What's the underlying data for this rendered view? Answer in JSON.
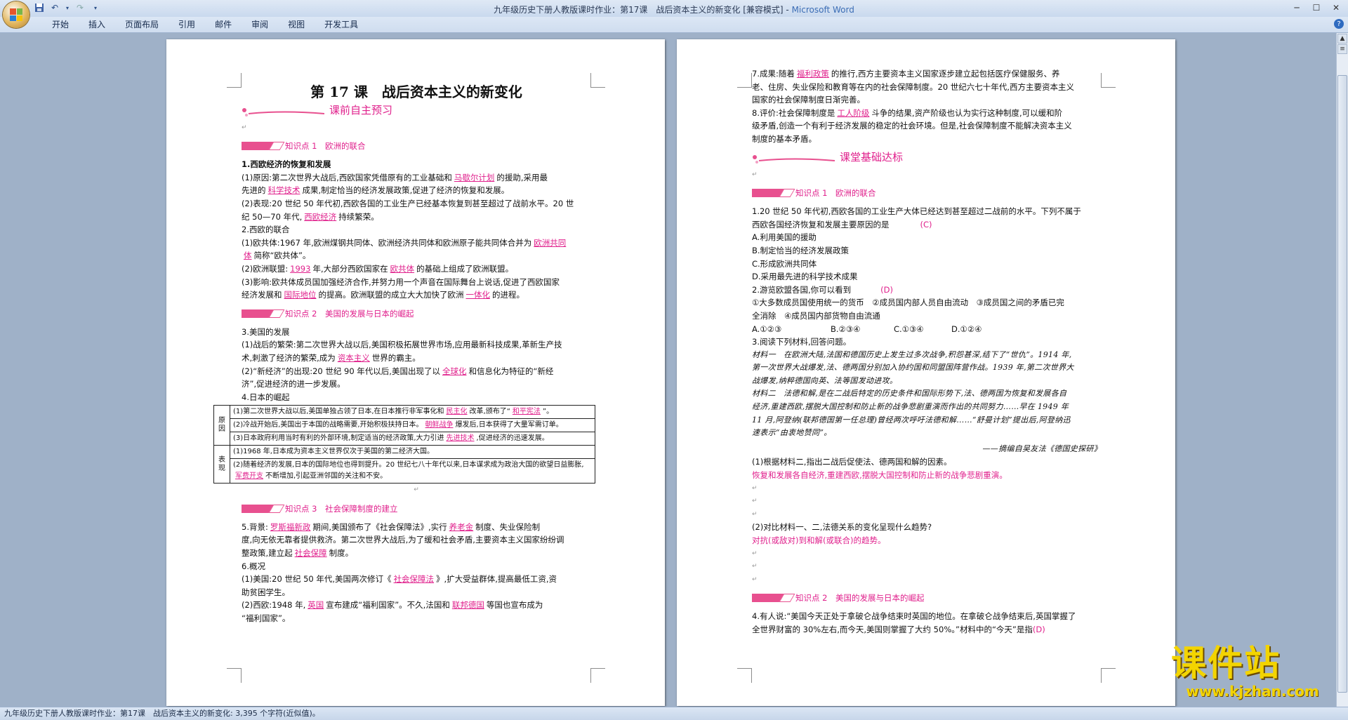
{
  "window": {
    "title": "九年级历史下册人教版课时作业：第17课　战后资本主义的新变化 [兼容模式]",
    "separator": " - ",
    "app": "Microsoft Word"
  },
  "menu": [
    "开始",
    "插入",
    "页面布局",
    "引用",
    "邮件",
    "审阅",
    "视图",
    "开发工具"
  ],
  "status": {
    "text": "九年级历史下册人教版课时作业：第17课　战后资本主义的新变化: 3,395 个字符(近似值)。"
  },
  "watermark": {
    "brand": "课件站",
    "url": "www.kjzhan.com"
  },
  "page1": {
    "title": "第 17 课　战后资本主义的新变化",
    "section_pre": "课前自主预习",
    "kp1": "知识点 1　欧洲的联合",
    "l1": "1.西欧经济的恢复和发展",
    "l2a": "(1)原因:第二次世界大战后,西欧国家凭借原有的工业基础和",
    "f1": "马歇尔计划",
    "l2b": "的援助,采用最",
    "l3a": "先进的",
    "f2": "科学技术",
    "l3b": "成果,制定恰当的经济发展政策,促进了经济的恢复和发展。",
    "l4": "(2)表现:20 世纪 50 年代初,西欧各国的工业生产已经基本恢复到甚至超过了战前水平。20 世",
    "l5a": "纪 50—70 年代,",
    "f3": "西欧经济",
    "l5b": "持续繁荣。",
    "l6": "2.西欧的联合",
    "l7a": "(1)欧共体:1967 年,欧洲煤钢共同体、欧洲经济共同体和欧洲原子能共同体合并为",
    "f4a": "欧洲共同",
    "f4b": "体",
    "l8b": "简称“欧共体”。",
    "l9a": "(2)欧洲联盟:",
    "f5": "1993",
    "l9b": "年,大部分西欧国家在",
    "f6": "欧共体",
    "l9c": "的基础上组成了欧洲联盟。",
    "l10": "(3)影响:欧共体成员国加强经济合作,并努力用一个声音在国际舞台上说话,促进了西欧国家",
    "l11a": "经济发展和",
    "f7": "国际地位",
    "l11b": "的提高。欧洲联盟的成立大大加快了欧洲",
    "f8": "一体化",
    "l11c": "的进程。",
    "kp2": "知识点 2　美国的发展与日本的崛起",
    "l12": "3.美国的发展",
    "l13": "(1)战后的繁荣:第二次世界大战以后,美国积极拓展世界市场,应用最新科技成果,革新生产技",
    "l14a": "术,刺激了经济的繁荣,成为",
    "f9": "资本主义",
    "l14b": "世界的霸主。",
    "l15a": "(2)“新经济”的出现:20 世纪 90 年代以后,美国出现了以",
    "f10": "全球化",
    "l15b": "和信息化为特征的“新经",
    "l16": "济”,促进经济的进一步发展。",
    "l17": "4.日本的崛起",
    "tbl": {
      "lab1": "原因",
      "lab2": "表现",
      "r1a": "(1)第二次世界大战以后,美国单独占领了日本,在日本推行非军事化和",
      "r1f1": "民主化",
      "r1b": "改革,颁布了“",
      "r1f2": "和平宪法",
      "r1c": "”。",
      "r2a": "(2)冷战开始后,美国出于本国的战略需要,开始积极扶持日本。",
      "r2f": "朝鲜战争",
      "r2b": "爆发后,日本获得了大量军需订单。",
      "r3a": "(3)日本政府利用当时有利的外部环境,制定适当的经济政策,大力引进",
      "r3f": "先进技术",
      "r3b": ",促进经济的迅速发展。",
      "r4": "(1)1968 年,日本成为资本主义世界仅次于美国的第二经济大国。",
      "r5a": "(2)随着经济的发展,日本的国际地位也得到提升。20 世纪七八十年代以来,日本谋求成为政治大国的欲望日益膨胀,",
      "r5f": "军费开支",
      "r5b": "不断增加,引起亚洲邻国的关注和不安。"
    },
    "kp3": "知识点 3　社会保障制度的建立",
    "l18a": "5.背景:",
    "f11": "罗斯福新政",
    "l18b": "期间,美国颁布了《社会保障法》,实行",
    "f12": "养老金",
    "l18c": "制度、失业保险制",
    "l19": "度,向无依无靠者提供救济。第二次世界大战后,为了缓和社会矛盾,主要资本主义国家纷纷调",
    "l20a": "整政策,建立起",
    "f13": "社会保障",
    "l20b": "制度。",
    "l21": "6.概况",
    "l22a": "(1)美国:20 世纪 50 年代,美国两次修订《",
    "f14": "社会保障法",
    "l22b": "》,扩大受益群体,提高最低工资,资",
    "l23": "助贫困学生。",
    "l24a": "(2)西欧:1948 年,",
    "f15": "英国",
    "l24b": "宣布建成“福利国家”。不久,法国和",
    "f16": "联邦德国",
    "l24c": "等国也宣布成为",
    "l25": "“福利国家”。"
  },
  "page2": {
    "l1a": "7.成果:随着",
    "f1": "福利政策",
    "l1b": "的推行,西方主要资本主义国家逐步建立起包括医疗保健服务、养",
    "l2": "老、住房、失业保险和教育等在内的社会保障制度。20 世纪六七十年代,西方主要资本主义",
    "l3": "国家的社会保障制度日渐完善。",
    "l4a": "8.评价:社会保障制度是",
    "f2": "工人阶级",
    "l4b": "斗争的结果,资产阶级也认为实行这种制度,可以缓和阶",
    "l5": "级矛盾,创造一个有利于经济发展的稳定的社会环境。但是,社会保障制度不能解决资本主义",
    "l6": "制度的基本矛盾。",
    "section_base": "课堂基础达标",
    "kp1": "知识点 1　欧洲的联合",
    "q1": "1.20 世纪 50 年代初,西欧各国的工业生产大体已经达到甚至超过二战前的水平。下列不属于",
    "q1b": "西欧各国经济恢复和发展主要原因的是",
    "q1ans": "(C)",
    "q1A": "A.利用美国的援助",
    "q1B": "B.制定恰当的经济发展政策",
    "q1C": "C.形成欧洲共同体",
    "q1D": "D.采用最先进的科学技术成果",
    "q2": "2.游览欧盟各国,你可以看到",
    "q2ans": "(D)",
    "q2a": "①大多数成员国使用统一的货币　②成员国内部人员自由流动　③成员国之间的矛盾已完",
    "q2b": "全消除　④成员国内部货物自由流通",
    "q2A": "A.①②③",
    "q2B": "B.②③④",
    "q2C": "C.①③④",
    "q2D": "D.①②④",
    "q3": "3.阅读下列材料,回答问题。",
    "m1a": "材料一　在欧洲大陆,法国和德国历史上发生过多次战争,积怨甚深,结下了“世仇”。1914 年,",
    "m1b": "第一次世界大战爆发,法、德两国分别加入协约国和同盟国阵营作战。1939 年,第二次世界大",
    "m1c": "战爆发,纳粹德国向英、法等国发动进攻。",
    "m2a": "材料二　法德和解,是在二战后特定的历史条件和国际形势下,法、德两国为恢复和发展各自",
    "m2b": "经济,重建西欧,摆脱大国控制和防止新的战争悲剧重演而作出的共同努力……早在 1949 年",
    "m2c": "11 月,阿登纳(联邦德国第一任总理)曾经两次呼吁法德和解……“舒曼计划”提出后,阿登纳迅",
    "m2d": "速表示“由衷地赞同”。",
    "src": "——摘编自吴友法《德国史探研》",
    "q31": "(1)根据材料二,指出二战后促使法、德两国和解的因素。",
    "a31": "恢复和发展各自经济,重建西欧,摆脱大国控制和防止新的战争悲剧重演。",
    "q32": "(2)对比材料一、二,法德关系的变化呈现什么趋势?",
    "a32": "对抗(或敌对)到和解(或联合)的趋势。",
    "kp2": "知识点 2　美国的发展与日本的崛起",
    "q4a": "4.有人说:“美国今天正处于拿破仑战争结束时英国的地位。在拿破仑战争结束后,英国掌握了",
    "q4b": "全世界财富的 30%左右,而今天,美国则掌握了大约 50%。”材料中的“今天”是指",
    "q4ans": "(D)"
  }
}
